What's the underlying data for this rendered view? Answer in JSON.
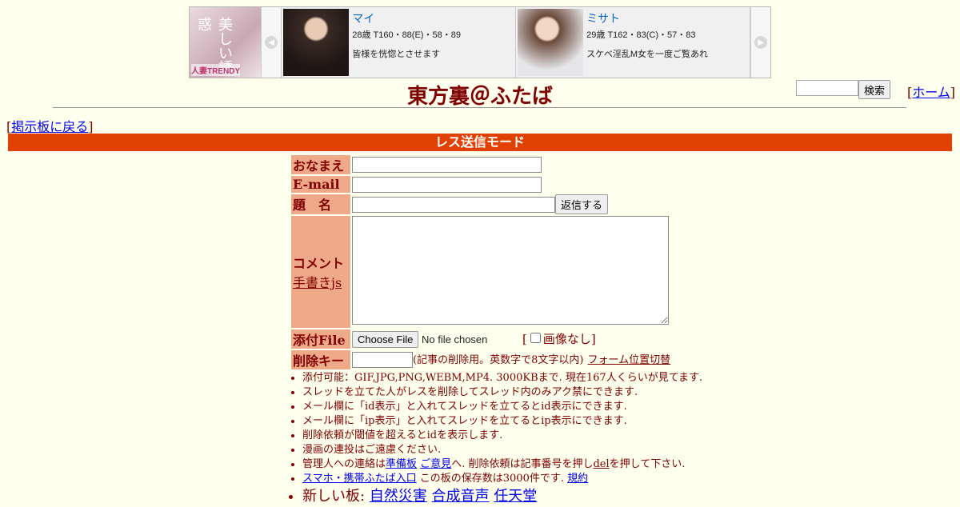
{
  "ad": {
    "banner_text": "美しい誘惑",
    "banner_brand": "人妻TRENDY",
    "prev_icon": "chevron-left-icon",
    "next_icon": "chevron-right-icon",
    "cards": [
      {
        "name": "マイ",
        "stats": "28歳 T160・88(E)・58・89",
        "desc": "皆様を恍惚とさせます"
      },
      {
        "name": "ミサト",
        "stats": "29歳 T162・83(C)・57・83",
        "desc": "スケベ淫乱M女を一度ご覧あれ"
      }
    ]
  },
  "header": {
    "title": "東方裏＠ふたば",
    "search_button": "検索",
    "home_link": "ホーム",
    "back_link": "掲示板に戻る",
    "mode_label": "レス送信モード"
  },
  "form": {
    "name_label": "おなまえ",
    "email_label": "E-mail",
    "subject_label": "題　名",
    "submit_button": "返信する",
    "comment_label": "コメント",
    "tegaki_link": "手書きjs",
    "file_label": "添付File",
    "file_button": "Choose File",
    "file_status": "No file chosen",
    "noimage_label": "画像なし",
    "delkey_label": "削除キー",
    "delkey_note": "(記事の削除用。英数字で8文字以内)",
    "form_pos_link": "フォーム位置切替"
  },
  "rules": [
    "添付可能：GIF,JPG,PNG,WEBM,MP4. 3000KBまで. 現在167人くらいが見てます.",
    "スレッドを立てた人がレスを削除してスレッド内のみアク禁にできます.",
    "メール欄に「id表示」と入れてスレッドを立てるとid表示にできます.",
    "メール欄に「ip表示」と入れてスレッドを立てるとip表示にできます.",
    "削除依頼が閾値を超えるとidを表示します.",
    "漫画の連投はご遠慮ください."
  ],
  "rule_contact": {
    "pre": "管理人への連絡は",
    "link1": "準備板",
    "link2": "ご意見",
    "mid": "へ. 削除依頼は記事番号を押し",
    "link3": "del",
    "post": "を押して下さい."
  },
  "rule_mobile": {
    "link": "スマホ・携帯ふたば入口",
    "text": " この板の保存数は3000件です.",
    "kiyaku": "規約"
  },
  "new_boards": {
    "label": "新しい板:",
    "links": [
      "自然災害",
      "合成音声",
      "任天堂"
    ]
  }
}
